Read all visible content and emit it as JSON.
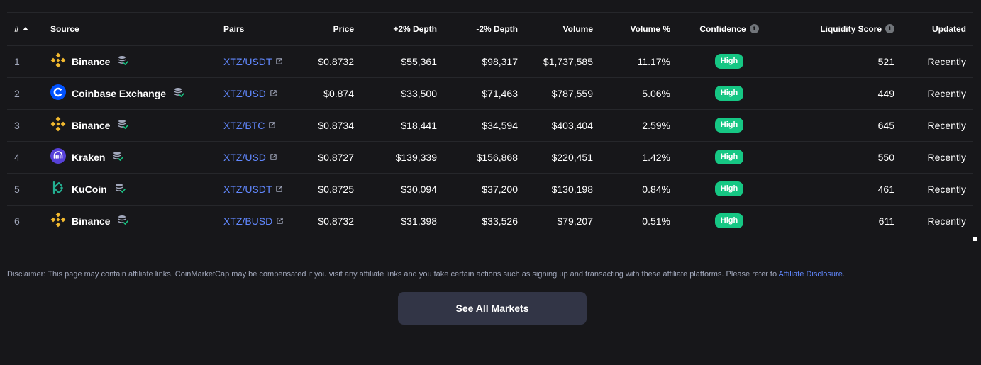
{
  "columns": {
    "rank": "#",
    "source": "Source",
    "pairs": "Pairs",
    "price": "Price",
    "depth_plus": "+2% Depth",
    "depth_minus": "-2% Depth",
    "volume": "Volume",
    "volume_pct": "Volume %",
    "confidence": "Confidence",
    "liquidity": "Liquidity Score",
    "updated": "Updated"
  },
  "rows": [
    {
      "rank": "1",
      "source": "Binance",
      "logo": "binance-logo",
      "pair": "XTZ/USDT",
      "price": "$0.8732",
      "depth_plus": "$55,361",
      "depth_minus": "$98,317",
      "volume": "$1,737,585",
      "volume_pct": "11.17%",
      "confidence": "High",
      "liquidity": "521",
      "updated": "Recently"
    },
    {
      "rank": "2",
      "source": "Coinbase Exchange",
      "logo": "coinbase-logo",
      "pair": "XTZ/USD",
      "price": "$0.874",
      "depth_plus": "$33,500",
      "depth_minus": "$71,463",
      "volume": "$787,559",
      "volume_pct": "5.06%",
      "confidence": "High",
      "liquidity": "449",
      "updated": "Recently"
    },
    {
      "rank": "3",
      "source": "Binance",
      "logo": "binance-logo",
      "pair": "XTZ/BTC",
      "price": "$0.8734",
      "depth_plus": "$18,441",
      "depth_minus": "$34,594",
      "volume": "$403,404",
      "volume_pct": "2.59%",
      "confidence": "High",
      "liquidity": "645",
      "updated": "Recently"
    },
    {
      "rank": "4",
      "source": "Kraken",
      "logo": "kraken-logo",
      "pair": "XTZ/USD",
      "price": "$0.8727",
      "depth_plus": "$139,339",
      "depth_minus": "$156,868",
      "volume": "$220,451",
      "volume_pct": "1.42%",
      "confidence": "High",
      "liquidity": "550",
      "updated": "Recently"
    },
    {
      "rank": "5",
      "source": "KuCoin",
      "logo": "kucoin-logo",
      "pair": "XTZ/USDT",
      "price": "$0.8725",
      "depth_plus": "$30,094",
      "depth_minus": "$37,200",
      "volume": "$130,198",
      "volume_pct": "0.84%",
      "confidence": "High",
      "liquidity": "461",
      "updated": "Recently"
    },
    {
      "rank": "6",
      "source": "Binance",
      "logo": "binance-logo",
      "pair": "XTZ/BUSD",
      "price": "$0.8732",
      "depth_plus": "$31,398",
      "depth_minus": "$33,526",
      "volume": "$79,207",
      "volume_pct": "0.51%",
      "confidence": "High",
      "liquidity": "611",
      "updated": "Recently"
    }
  ],
  "disclaimer": {
    "text": "Disclaimer: This page may contain affiliate links. CoinMarketCap may be compensated if you visit any affiliate links and you take certain actions such as signing up and transacting with these affiliate platforms. Please refer to ",
    "link": "Affiliate Disclosure",
    "suffix": "."
  },
  "see_all_label": "See All Markets",
  "colors": {
    "background": "#17171a",
    "link": "#6188ff",
    "badge_high": "#16c784",
    "button": "#323546",
    "divider": "#26272b"
  }
}
